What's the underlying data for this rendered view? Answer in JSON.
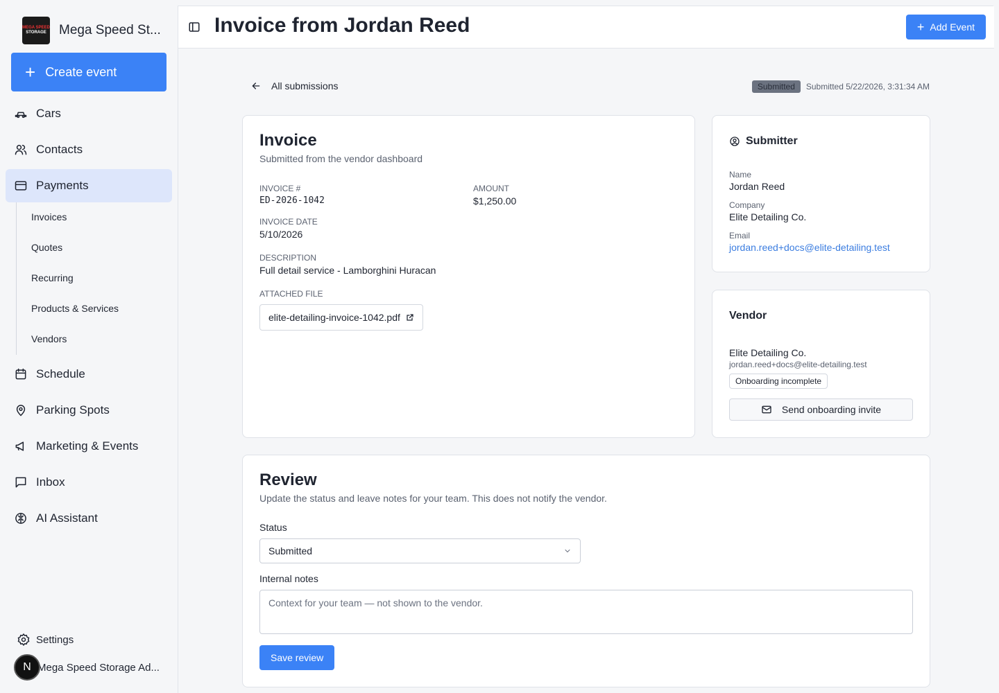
{
  "app": {
    "brand_name": "Mega Speed St...",
    "logo_text_1": "MEGA SPEED",
    "logo_text_2": "STORAGE",
    "create_label": "Create event"
  },
  "sidebar": {
    "items": [
      {
        "label": "Cars",
        "icon": "car-icon"
      },
      {
        "label": "Contacts",
        "icon": "users-icon"
      },
      {
        "label": "Payments",
        "icon": "credit-card-icon"
      },
      {
        "label": "Schedule",
        "icon": "calendar-icon"
      },
      {
        "label": "Parking Spots",
        "icon": "map-pin-icon"
      },
      {
        "label": "Marketing & Events",
        "icon": "megaphone-icon"
      },
      {
        "label": "Inbox",
        "icon": "message-square-icon"
      },
      {
        "label": "AI Assistant",
        "icon": "brain-icon"
      }
    ],
    "sub_items": [
      "Invoices",
      "Quotes",
      "Recurring",
      "Products & Services",
      "Vendors"
    ],
    "settings_label": "Settings",
    "account_initial": "N",
    "account_name": "Mega Speed Storage Ad..."
  },
  "header": {
    "title": "Invoice from Jordan Reed",
    "add_event_label": "Add Event"
  },
  "status_bar": {
    "back_label": "All submissions",
    "badge": "Submitted",
    "submitted_text": "Submitted 5/22/2026, 3:31:34 AM"
  },
  "invoice": {
    "title": "Invoice",
    "subtitle": "Submitted from the vendor dashboard",
    "number_label": "INVOICE #",
    "number": "ED-2026-1042",
    "amount_label": "AMOUNT",
    "amount": "$1,250.00",
    "date_label": "INVOICE DATE",
    "date": "5/10/2026",
    "description_label": "DESCRIPTION",
    "description": "Full detail service - Lamborghini Huracan",
    "file_label": "ATTACHED FILE",
    "file_name": "elite-detailing-invoice-1042.pdf"
  },
  "submitter": {
    "title": "Submitter",
    "name_label": "Name",
    "name": "Jordan Reed",
    "company_label": "Company",
    "company": "Elite Detailing Co.",
    "email_label": "Email",
    "email": "jordan.reed+docs@elite-detailing.test"
  },
  "vendor": {
    "title": "Vendor",
    "name": "Elite Detailing Co.",
    "email": "jordan.reed+docs@elite-detailing.test",
    "chip": "Onboarding incomplete",
    "invite_label": "Send onboarding invite"
  },
  "review": {
    "title": "Review",
    "subtitle": "Update the status and leave notes for your team. This does not notify the vendor.",
    "status_label": "Status",
    "status_value": "Submitted",
    "notes_label": "Internal notes",
    "notes_placeholder": "Context for your team — not shown to the vendor.",
    "save_label": "Save review"
  }
}
